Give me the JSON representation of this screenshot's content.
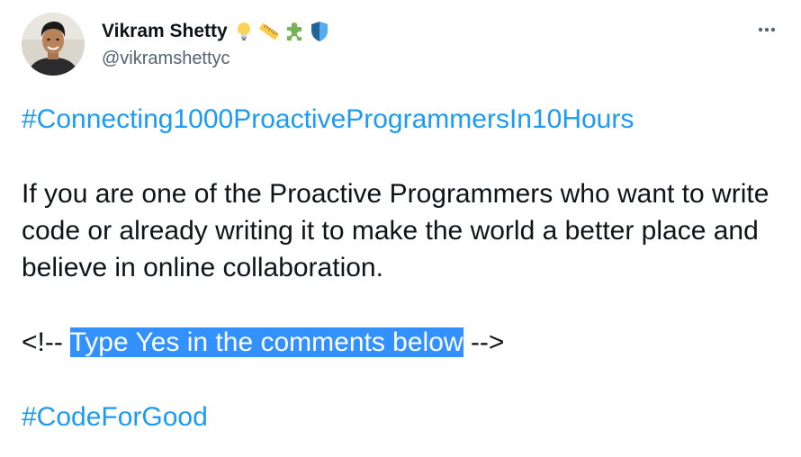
{
  "author": {
    "display_name": "Vikram Shetty",
    "handle": "@vikramshettyc",
    "badges": [
      "light-bulb-icon",
      "ruler-icon",
      "puzzle-piece-icon",
      "shield-icon"
    ]
  },
  "more_button": {
    "icon": "more-horizontal-icon",
    "label": "•••"
  },
  "tweet": {
    "hashtag_top": "#Connecting1000ProactiveProgrammersIn10Hours",
    "paragraph": "If you are one of the Proactive Programmers who want to write code or already writing it to make the world a better place and believe in online collaboration.",
    "comment_open": "<!-- ",
    "comment_selected": "Type Yes in the comments below",
    "comment_close": " -->",
    "hashtag_bottom": "#CodeForGood"
  },
  "colors": {
    "link": "#1d9bf0",
    "selection": "#3390ff",
    "text": "#0f1419",
    "secondary": "#536471"
  }
}
